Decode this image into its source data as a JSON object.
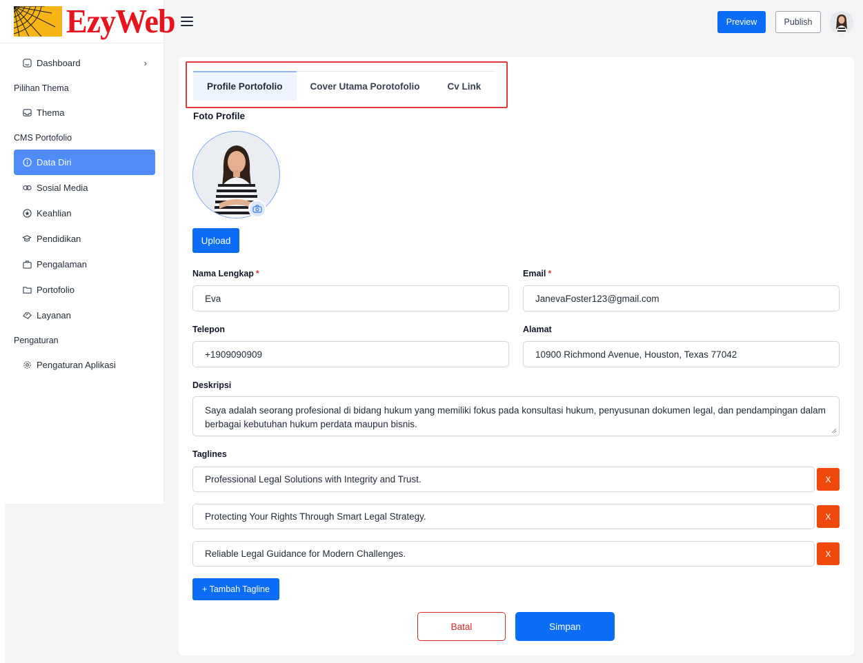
{
  "app": {
    "logo_text": "EzyWeb"
  },
  "header": {
    "preview_label": "Preview",
    "publish_label": "Publish"
  },
  "sidebar": {
    "dashboard": "Dashboard",
    "section_tema": "Pilihan Thema",
    "thema": "Thema",
    "section_cms": "CMS Portofolio",
    "data_diri": "Data Diri",
    "sosial_media": "Sosial Media",
    "keahlian": "Keahlian",
    "pendidikan": "Pendidikan",
    "pengalaman": "Pengalaman",
    "portofolio": "Portofolio",
    "layanan": "Layanan",
    "section_pengaturan": "Pengaturan",
    "pengaturan_aplikasi": "Pengaturan Aplikasi"
  },
  "tabs": [
    "Profile Portofolio",
    "Cover Utama Porotofolio",
    "Cv Link"
  ],
  "form": {
    "foto_title": "Foto Profile",
    "upload_label": "Upload",
    "nama_label": "Nama Lengkap",
    "nama_value": "Eva",
    "email_label": "Email",
    "email_value": "JanevaFoster123@gmail.com",
    "required_mark": "*",
    "telepon_label": "Telepon",
    "telepon_value": "+1909090909",
    "alamat_label": "Alamat",
    "alamat_value": "10900 Richmond Avenue, Houston, Texas 77042",
    "deskripsi_label": "Deskripsi",
    "deskripsi_value": "Saya adalah seorang profesional di bidang hukum yang memiliki fokus pada konsultasi hukum, penyusunan dokumen legal, dan pendampingan dalam berbagai kebutuhan hukum perdata maupun bisnis.",
    "taglines_label": "Taglines",
    "taglines": [
      "Professional Legal Solutions with Integrity and Trust.",
      "Protecting Your Rights Through Smart Legal Strategy.",
      "Reliable Legal Guidance for Modern Challenges."
    ],
    "remove_label": "X",
    "add_tagline_label": "+ Tambah Tagline",
    "batal_label": "Batal",
    "simpan_label": "Simpan"
  },
  "colors": {
    "primary": "#0b6cf5",
    "active_nav": "#4f8cf7",
    "danger": "#ef4a0c",
    "highlight_box": "#e0383b",
    "logo_red": "#e8141b",
    "logo_yellow": "#f6b514"
  }
}
